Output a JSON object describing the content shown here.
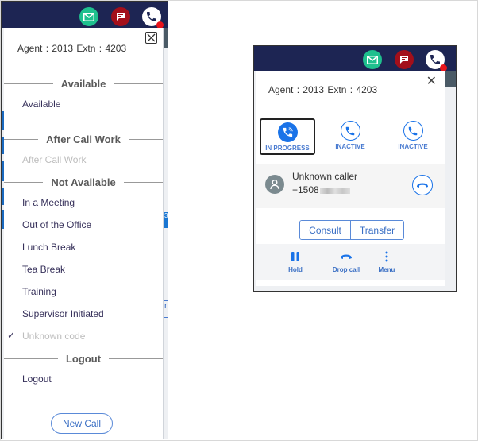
{
  "left_panel": {
    "agent_label": "Agent :",
    "agent_id": "2013",
    "extn_label": "Extn :",
    "extn": "4203",
    "sections": [
      {
        "title": "Available",
        "items": [
          {
            "label": "Available",
            "disabled": false
          }
        ]
      },
      {
        "title": "After Call Work",
        "items": [
          {
            "label": "After Call Work",
            "disabled": true
          }
        ]
      },
      {
        "title": "Not Available",
        "items": [
          {
            "label": "In a Meeting",
            "disabled": false
          },
          {
            "label": "Out of the Office",
            "disabled": false
          },
          {
            "label": "Lunch Break",
            "disabled": false
          },
          {
            "label": "Tea Break",
            "disabled": false
          },
          {
            "label": "Training",
            "disabled": false
          },
          {
            "label": "Supervisor Initiated",
            "disabled": false
          },
          {
            "label": "Unknown code",
            "disabled": true,
            "checked": true
          }
        ]
      },
      {
        "title": "Logout",
        "items": [
          {
            "label": "Logout",
            "disabled": false
          }
        ]
      }
    ],
    "new_call_label": "New Call",
    "bg_fragment_tab": "3",
    "bg_fragment_text": "n"
  },
  "right_panel": {
    "agent_label": "Agent :",
    "agent_id": "2013",
    "extn_label": "Extn :",
    "extn": "4203",
    "lines": [
      {
        "label": "IN PROGRESS",
        "active": true
      },
      {
        "label": "INACTIVE",
        "active": false
      },
      {
        "label": "INACTIVE",
        "active": false
      }
    ],
    "caller": {
      "name": "Unknown caller",
      "number_prefix": "+1508"
    },
    "consult_label": "Consult",
    "transfer_label": "Transfer",
    "actions": [
      {
        "label": "Hold",
        "icon": "pause-icon"
      },
      {
        "label": "Drop call",
        "icon": "hangup-icon"
      },
      {
        "label": "Menu",
        "icon": "kebab-menu-icon"
      }
    ]
  },
  "colors": {
    "navbar": "#1d2553",
    "mail": "#1fc08e",
    "chat": "#a30f1a",
    "accent": "#1a73e8",
    "badge": "#e8141b"
  }
}
